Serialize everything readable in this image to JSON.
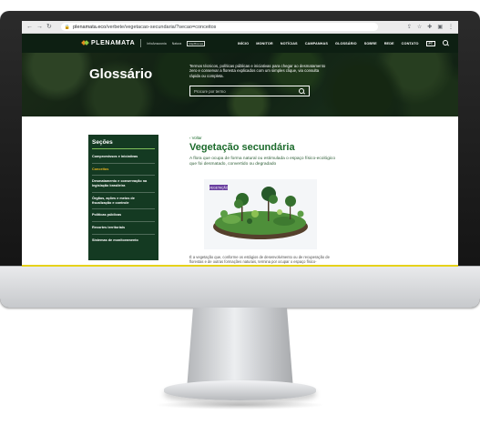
{
  "browser": {
    "url_host": "plenamata.eco",
    "url_path": "/verbete/vegetacao-secundaria/?secao=conceitos"
  },
  "nav": {
    "logo": "PLENAMATA",
    "partners": [
      "InfoAmazonia",
      "Natura",
      "MapBiomas"
    ],
    "menu": [
      "INÍCIO",
      "MONITOR",
      "NOTÍCIAS",
      "CAMPANHAS",
      "GLOSSÁRIO",
      "SOBRE",
      "REDE",
      "CONTATO"
    ],
    "lang": "PT"
  },
  "hero": {
    "title": "Glossário",
    "description": "Termos técnicos, políticas públicas e iniciativas para chegar ao desmatamento zero e conservar a floresta explicados com um simples clique, via consulta rápida ou completa.",
    "search_placeholder": "Procure por termo"
  },
  "sidebar": {
    "title": "Seções",
    "items": [
      {
        "label": "Compromissos e iniciativas",
        "active": false
      },
      {
        "label": "Conceitos",
        "active": true
      },
      {
        "label": "Desmatamento e conservação na legislação brasileira",
        "active": false
      },
      {
        "label": "Órgãos, ações e meios de fiscalização e controle",
        "active": false
      },
      {
        "label": "Políticas públicas",
        "active": false
      },
      {
        "label": "Recortes territoriais",
        "active": false
      },
      {
        "label": "Sistemas de monitoramento",
        "active": false
      }
    ]
  },
  "article": {
    "back": "‹ Voltar",
    "title": "Vegetação secundária",
    "definition": "A flora que ocupa de forma natural ou estimulada o espaço físico-ecológico que foi desmatado, convertido ou degradado",
    "illustration_tag": "VEGETAÇÃO",
    "body": "É a vegetação que, conforme os estágios de desenvolvimento ou de recuperação de florestas e de outras formações naturais, termina por ocupar o espaço físico-"
  },
  "colors": {
    "nav_bg": "#0d1f12",
    "sidebar_bg": "#143a22",
    "accent_green": "#1c6b2c",
    "active_section": "#e8b21e",
    "illustration_tag": "#6a3fa0"
  }
}
